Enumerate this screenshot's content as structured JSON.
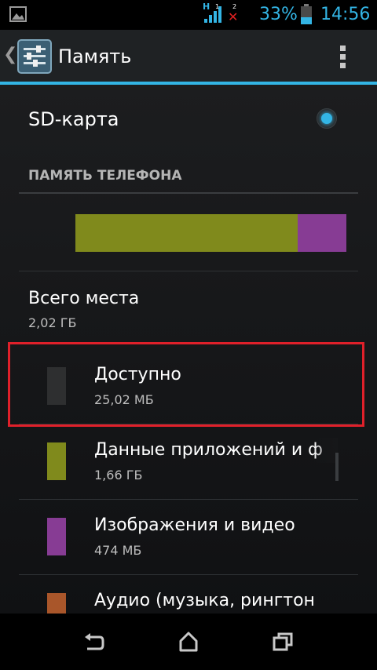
{
  "status_bar": {
    "network_type": "H",
    "sim1_label": "1",
    "sim2_label": "2",
    "battery_percent": "33%",
    "time": "14:56",
    "accent_color": "#33b5e5",
    "no_signal_color": "#e02020"
  },
  "action_bar": {
    "title": "Память",
    "up_icon": "chevron-left-icon",
    "app_icon": "settings-sliders-icon",
    "overflow_icon": "overflow-menu-icon"
  },
  "sd_card": {
    "label": "SD-карта",
    "selected": true
  },
  "phone_memory": {
    "section_header": "ПАМЯТЬ ТЕЛЕФОНА",
    "usage_bar": [
      {
        "name": "app-data",
        "fraction": 0.82,
        "color": "#808a1c"
      },
      {
        "name": "images-video",
        "fraction": 0.18,
        "color": "#873c94"
      }
    ],
    "total": {
      "title": "Всего места",
      "value": "2,02 ГБ"
    },
    "categories": [
      {
        "title": "Доступно",
        "value": "25,02 МБ",
        "color": "#2e2f30"
      },
      {
        "title": "Данные приложений и ф",
        "value": "1,66 ГБ",
        "color": "#808a1c"
      },
      {
        "title": "Изображения и видео",
        "value": "474 МБ",
        "color": "#873c94"
      },
      {
        "title": "Аудио (музыка, рингтон",
        "value": "",
        "color": "#a9562a"
      }
    ]
  },
  "nav_bar": {
    "back_icon": "back-icon",
    "home_icon": "home-icon",
    "recents_icon": "recents-icon"
  }
}
